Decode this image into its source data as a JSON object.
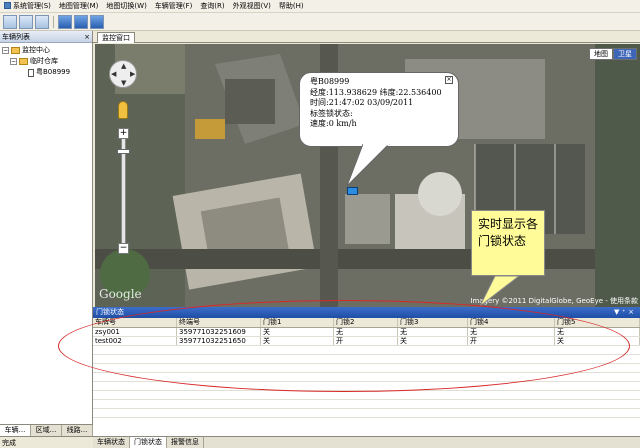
{
  "menu": [
    {
      "label": "系统管理(S)"
    },
    {
      "label": "地图管理(M)"
    },
    {
      "label": "地图切换(W)"
    },
    {
      "label": "车辆管理(F)"
    },
    {
      "label": "查询(R)"
    },
    {
      "label": "外观视图(V)"
    },
    {
      "label": "帮助(H)"
    }
  ],
  "left_panel": {
    "title": "车辆列表",
    "tree": {
      "root": "监控中心",
      "group": "临时仓库",
      "vehicle": "粤B08999"
    },
    "tabs": [
      "车辆...",
      "区域...",
      "线路..."
    ]
  },
  "status_text": "完成",
  "doc_tab": "监控窗口",
  "map": {
    "type_buttons": [
      "地图",
      "卫星"
    ],
    "active_type": "卫星",
    "logo": "Google",
    "attribution": "Imagery ©2011 DigitalGlobe, GeoEye - 使用条款",
    "popup": {
      "lines": [
        "粤B08999",
        "经度:113.938629 纬度:22.536400",
        "时间:21:47:02 03/09/2011",
        "标签锁状态:",
        "速度:0 km/h"
      ]
    },
    "callout": "实时显示各门锁状态"
  },
  "lock_panel": {
    "title": "门锁状态",
    "columns": [
      "车牌号",
      "终端号",
      "门锁1",
      "门锁2",
      "门锁3",
      "门锁4",
      "门锁5"
    ],
    "rows": [
      [
        "zsy001",
        "359771032251609",
        "关",
        "无",
        "无",
        "无",
        "无"
      ],
      [
        "test002",
        "359771032251650",
        "关",
        "开",
        "关",
        "开",
        "关"
      ]
    ]
  },
  "bottom_tabs": [
    "车辆状态",
    "门锁状态",
    "报警信息"
  ],
  "active_bottom_tab": "门锁状态"
}
